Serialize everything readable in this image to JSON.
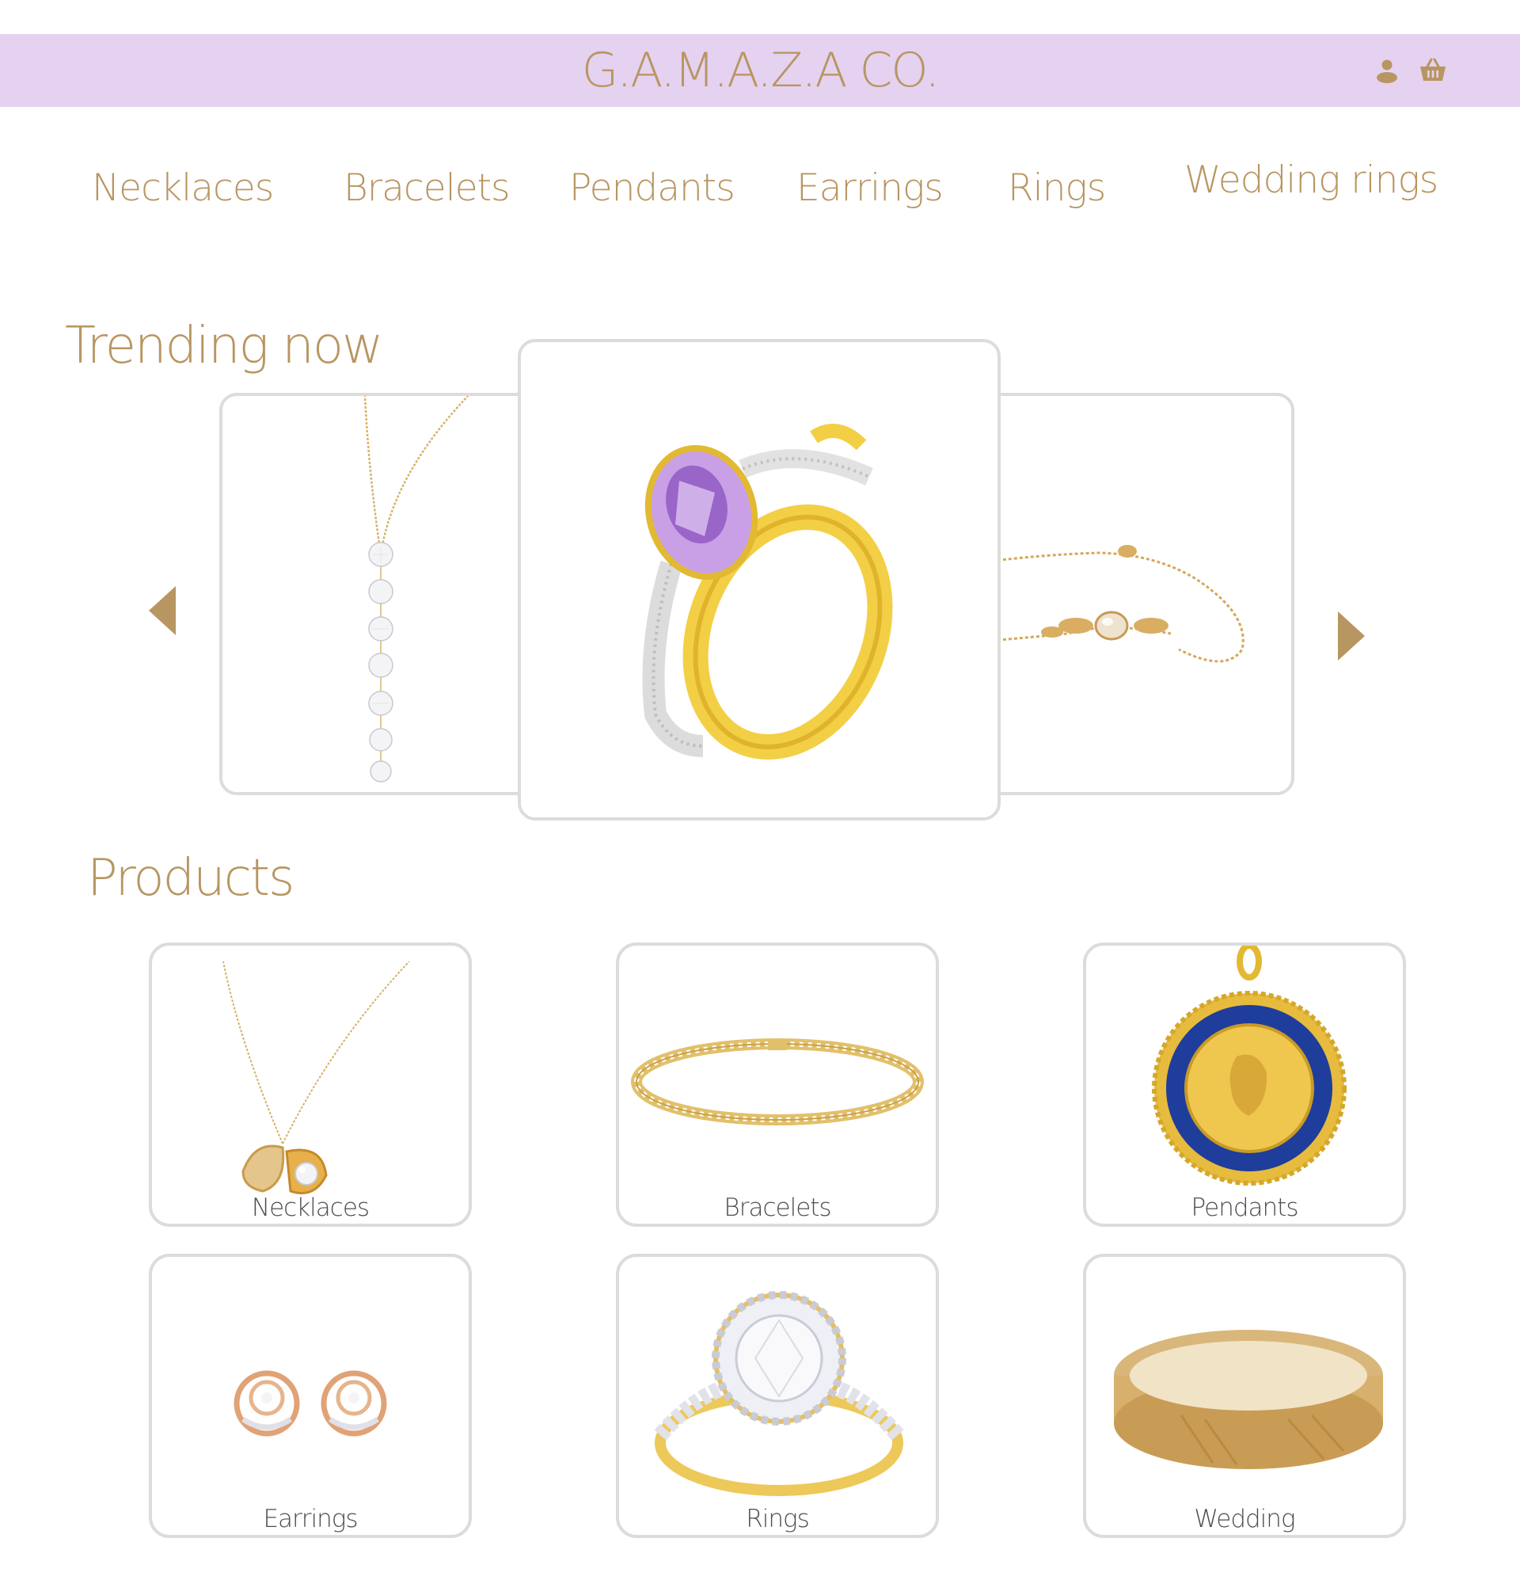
{
  "brand": {
    "logo": "G.A.M.A.Z.A CO.",
    "accent_color": "#b89662",
    "header_color": "#e5d2f1"
  },
  "header_icons": {
    "user": "user-icon",
    "cart": "basket-icon"
  },
  "nav": {
    "items": [
      {
        "label": "Necklaces"
      },
      {
        "label": "Bracelets"
      },
      {
        "label": "Pendants"
      },
      {
        "label": "Earrings"
      },
      {
        "label": "Rings"
      },
      {
        "label": "Wedding rings"
      }
    ]
  },
  "trending": {
    "title": "Trending now",
    "slides": [
      {
        "image": "drop-diamond-necklace"
      },
      {
        "image": "amethyst-gold-ring"
      },
      {
        "image": "floral-opal-bracelet"
      }
    ],
    "prev_icon": "triangle-left-icon",
    "next_icon": "triangle-right-icon"
  },
  "products": {
    "title": "Products",
    "items": [
      {
        "label": "Necklaces",
        "image": "pearl-shell-necklace"
      },
      {
        "label": "Bracelets",
        "image": "diamond-tennis-bracelet"
      },
      {
        "label": "Pendants",
        "image": "gold-coin-pendant"
      },
      {
        "label": "Earrings",
        "image": "rose-gold-stud-earrings"
      },
      {
        "label": "Rings",
        "image": "halo-diamond-ring"
      },
      {
        "label": "Wedding",
        "image": "gold-wedding-band"
      }
    ]
  }
}
